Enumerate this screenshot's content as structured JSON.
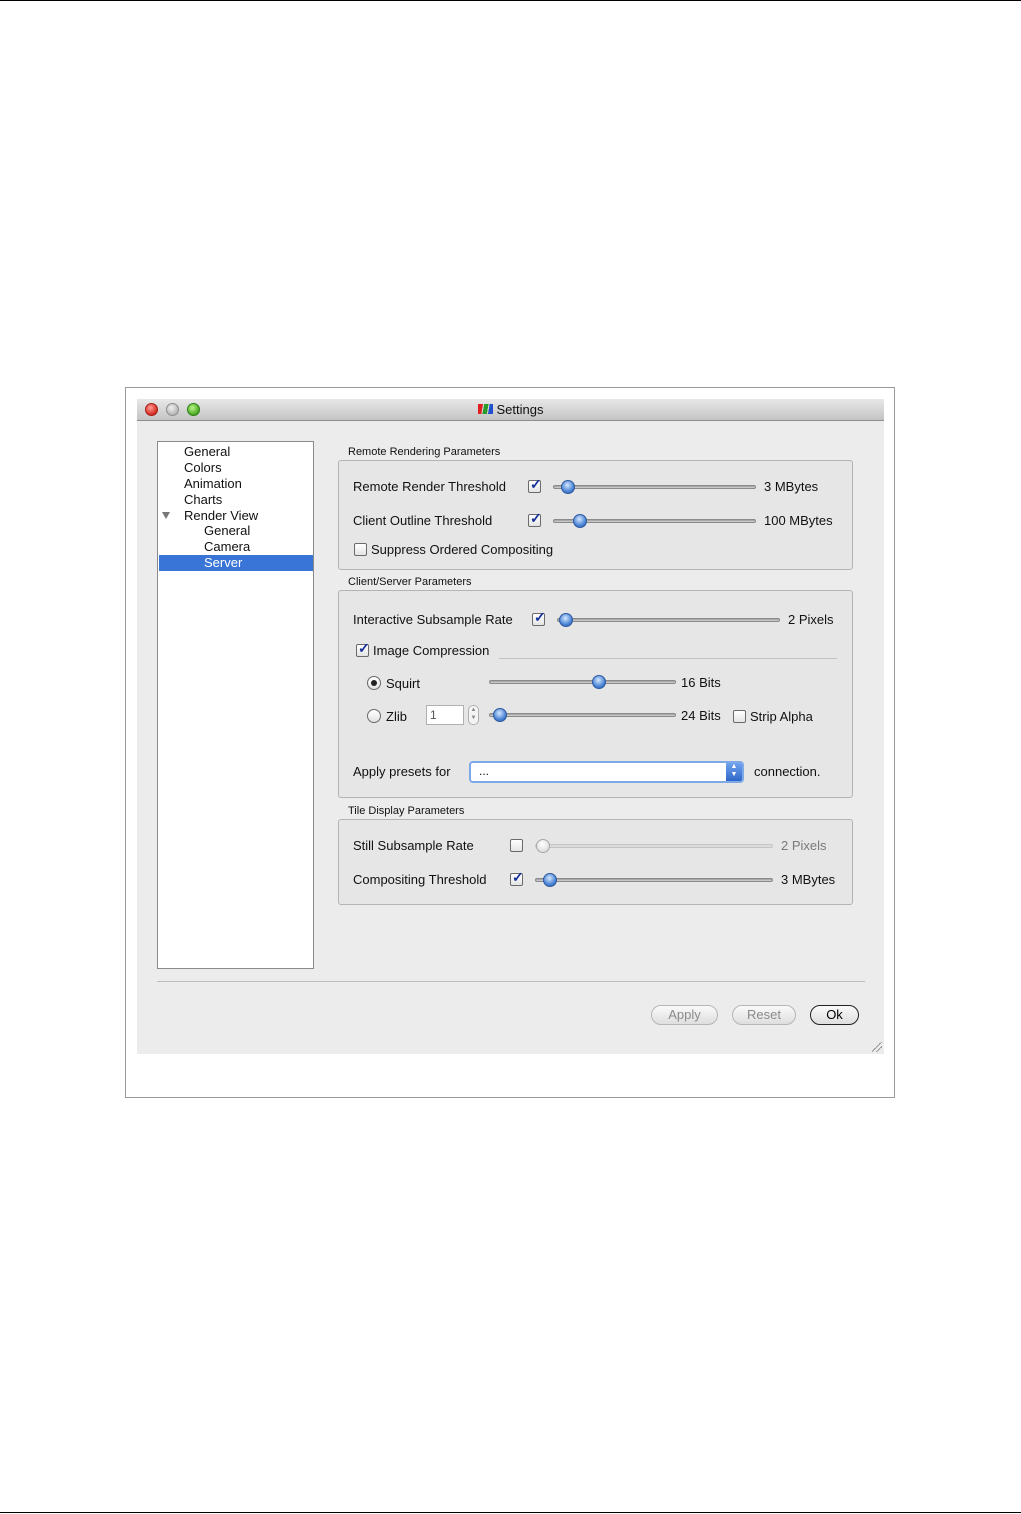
{
  "window": {
    "title": "Settings"
  },
  "tree": {
    "items": [
      {
        "label": "General"
      },
      {
        "label": "Colors"
      },
      {
        "label": "Animation"
      },
      {
        "label": "Charts"
      },
      {
        "label": "Render View",
        "expanded": true
      },
      {
        "label": "General"
      },
      {
        "label": "Camera"
      },
      {
        "label": "Server",
        "selected": true
      }
    ]
  },
  "remote_rendering": {
    "title": "Remote Rendering Parameters",
    "remote_render_threshold": {
      "label": "Remote Render Threshold",
      "checked": true,
      "value_text": "3 MBytes"
    },
    "client_outline_threshold": {
      "label": "Client Outline Threshold",
      "checked": true,
      "value_text": "100 MBytes"
    },
    "suppress_ordered_compositing": {
      "label": "Suppress Ordered Compositing",
      "checked": false
    }
  },
  "client_server": {
    "title": "Client/Server Parameters",
    "interactive_subsample_rate": {
      "label": "Interactive Subsample Rate",
      "checked": true,
      "value_text": "2 Pixels"
    },
    "image_compression": {
      "label": "Image Compression",
      "checked": true
    },
    "squirt": {
      "label": "Squirt",
      "selected": true,
      "value_text": "16 Bits"
    },
    "zlib": {
      "label": "Zlib",
      "selected": false,
      "level": "1",
      "value_text": "24 Bits"
    },
    "strip_alpha": {
      "label": "Strip Alpha",
      "checked": false
    },
    "presets": {
      "label": "Apply presets for",
      "value": "...",
      "suffix": "connection."
    }
  },
  "tile_display": {
    "title": "Tile Display Parameters",
    "still_subsample_rate": {
      "label": "Still Subsample Rate",
      "checked": false,
      "value_text": "2 Pixels"
    },
    "compositing_threshold": {
      "label": "Compositing Threshold",
      "checked": true,
      "value_text": "3 MBytes"
    }
  },
  "buttons": {
    "apply": "Apply",
    "reset": "Reset",
    "ok": "Ok"
  },
  "colors": {
    "selection": "#3875d7",
    "knob": "#4d86d6"
  }
}
